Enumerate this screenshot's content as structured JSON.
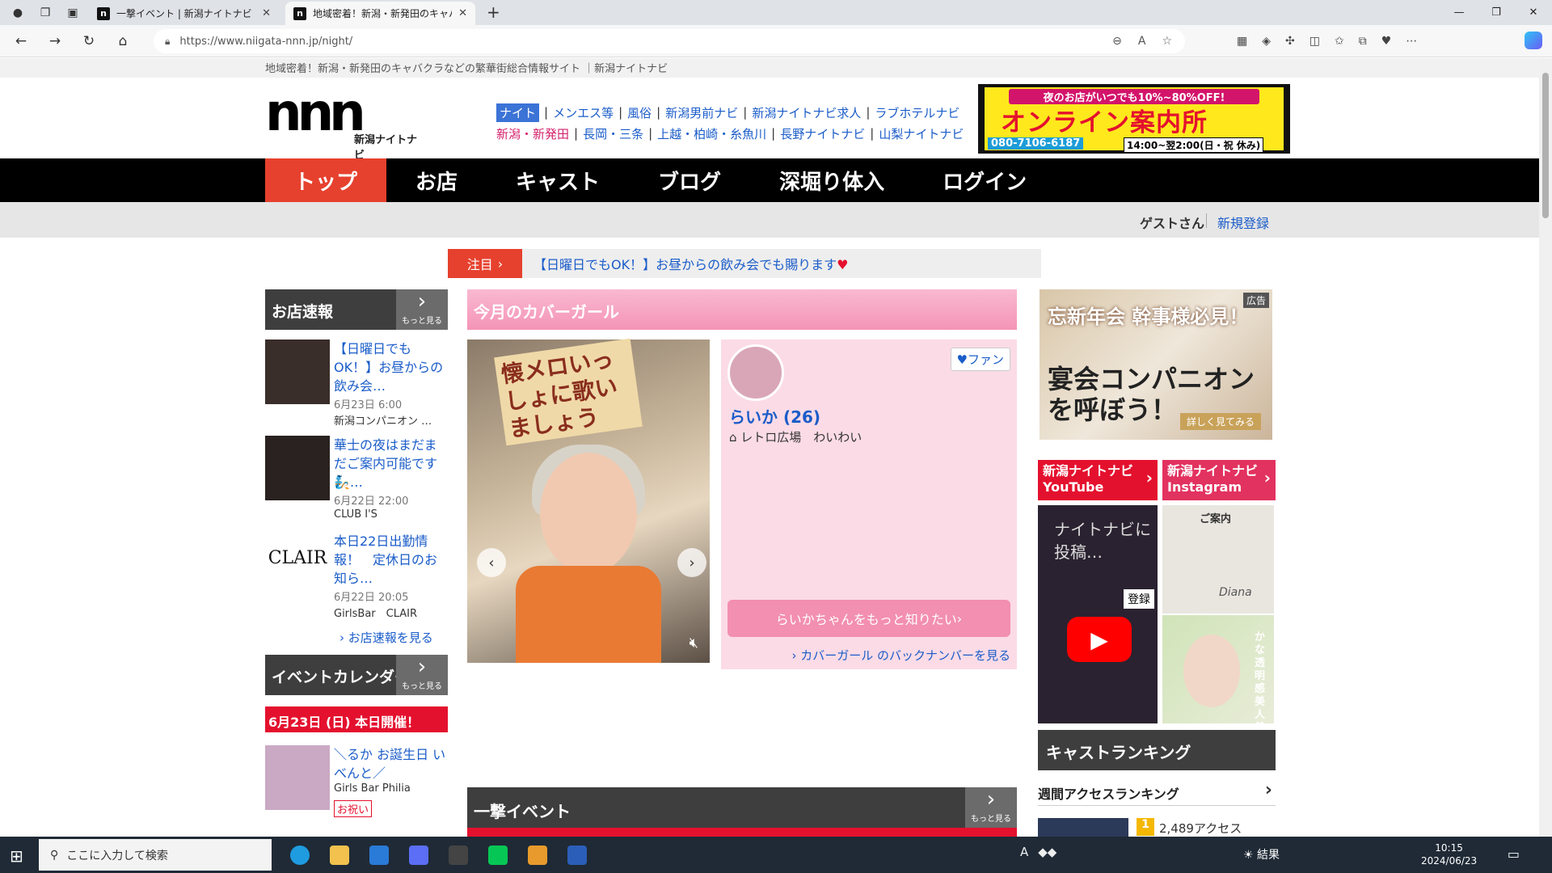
{
  "browser": {
    "tabs": [
      {
        "title": "一撃イベント | 新潟ナイトナビ",
        "active": false
      },
      {
        "title": "地域密着！新潟・新発田のキャバク",
        "active": true
      }
    ],
    "url": "https://www.niigata-nnn.jp/night/"
  },
  "site": {
    "tagline": "地域密着！新潟・新発田のキャバクラなどの繁華街総合情報サイト ｜新潟ナイトナビ",
    "logo_text": "nnn",
    "logo_sub": "新潟ナイトナビ",
    "top_links_row1": [
      "ナイト",
      "メンエス等",
      "風俗",
      "新潟男前ナビ",
      "新潟ナイトナビ求人",
      "ラブホテルナビ"
    ],
    "top_links_row2": [
      "新潟・新発田",
      "長岡・三条",
      "上越・柏崎・糸魚川",
      "長野ナイトナビ",
      "山梨ナイトナビ"
    ],
    "banner": {
      "line1": "夜のお店がいつでも10%~80%OFF!",
      "line2": "オンライン案内所",
      "phone": "080-7106-6187",
      "hours": "14:00~翌2:00(日・祝 休み)"
    },
    "main_nav": [
      "トップ",
      "お店",
      "キャスト",
      "ブログ",
      "深堀り体入",
      "ログイン"
    ],
    "user": {
      "guest": "ゲストさん",
      "register": "新規登録"
    },
    "notice": {
      "label": "注目",
      "text": "【日曜日でもOK！】お昼からの飲み会でも賜ります",
      "heart": "♥"
    }
  },
  "left": {
    "shop_news_title": "お店速報",
    "more_label": "もっと見る",
    "news": [
      {
        "title": "【日曜日でもOK！】お昼からの飲み会…",
        "date": "6月23日 6:00",
        "shop": "新潟コンパニオン …"
      },
      {
        "title": "華士の夜はまだまだご案内可能です🧞…",
        "date": "6月22日 22:00",
        "shop": "CLUB I'S"
      },
      {
        "title": "本日22日出勤情報！　定休日のお知ら…",
        "date": "6月22日 20:05",
        "shop": "GirlsBar　CLAIR"
      }
    ],
    "news_more": "お店速報を見る",
    "event_cal_title": "イベントカレンダー",
    "event_date": "6月23日 (日) 本日開催！",
    "bday": {
      "title": "＼るか お誕生日 いべんと／",
      "shop": "Girls Bar Philia",
      "tag": "お祝い"
    }
  },
  "center": {
    "cover_title": "今月のカバーガール",
    "photo_sign": "懐メロいっしょに歌いましょう",
    "name": "らいか (26)",
    "shop": "レトロ広場　わいわい",
    "fan": "ファン",
    "more_btn": "らいかちゃんをもっと知りたい",
    "backnumber": "カバーガール のバックナンバーを見る",
    "event_title": "一撃イベント"
  },
  "right": {
    "ad_tag": "広告",
    "ad_line1": "忘新年会 幹事様必見！",
    "ad_line2": "宴会コンパニオンを呼ぼう！",
    "ad_btn": "詳しく見てみる",
    "youtube": "新潟ナイトナビ YouTube",
    "instagram": "新潟ナイトナビ Instagram",
    "yt_text": "ナイトナビに投稿…",
    "yt_reg": "登録",
    "ig1_title": "ご案内",
    "ig1_brand": "Diana",
    "ig2_text": "かな透明感美人美女",
    "rank_title": "キャストランキング",
    "weekly": "週間アクセスランキング",
    "rank1": {
      "no": "1",
      "count": "2,489アクセス"
    }
  },
  "taskbar": {
    "search": "ここに入力して検索",
    "weather": "結果",
    "time": "10:15",
    "date": "2024/06/23"
  }
}
